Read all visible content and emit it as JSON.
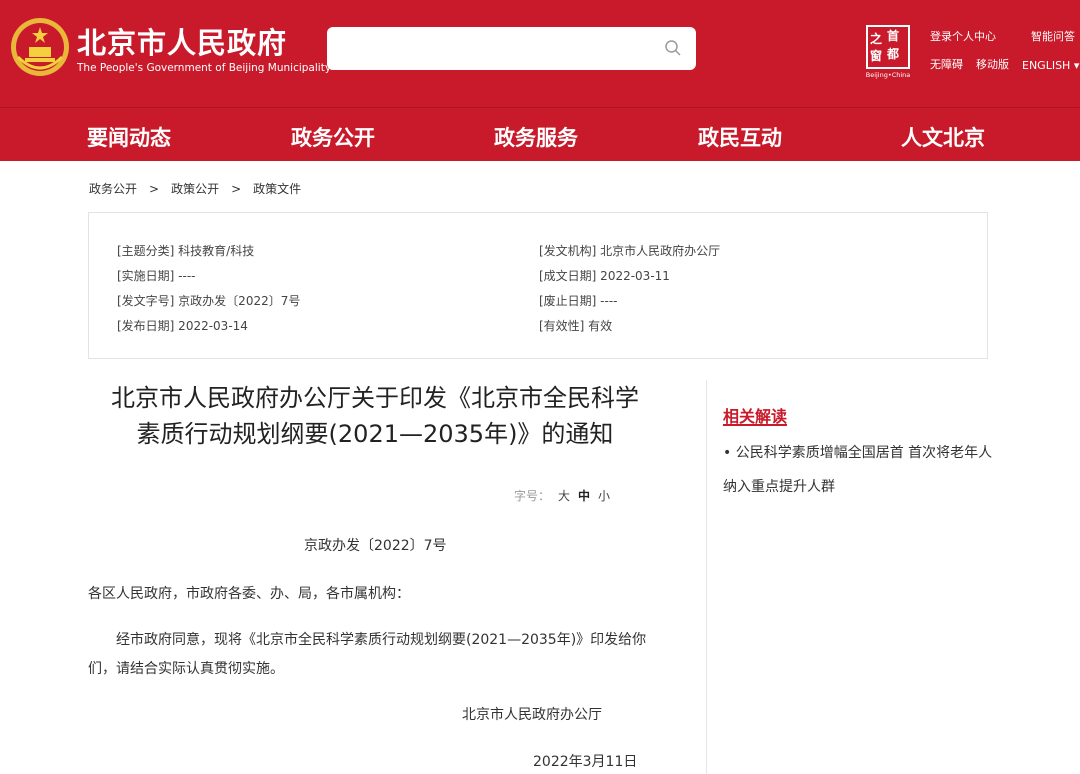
{
  "header": {
    "site_title": "北京市人民政府",
    "site_subtitle": "The People's Government of Beijing Municipality",
    "search": {
      "placeholder": ""
    },
    "capital_logo": {
      "glyphs": [
        "之",
        "首",
        "窗",
        "都"
      ],
      "caption": "Beijing•China"
    },
    "links": {
      "login": "登录个人中心",
      "smart_qa": "智能问答",
      "accessible": "无障碍",
      "mobile": "移动版",
      "english": "ENGLISH ▾"
    },
    "colors": {
      "brand_red": "#c81a2a"
    }
  },
  "nav": {
    "items": [
      {
        "label": "要闻动态"
      },
      {
        "label": "政务公开"
      },
      {
        "label": "政务服务"
      },
      {
        "label": "政民互动"
      },
      {
        "label": "人文北京"
      }
    ]
  },
  "breadcrumb": {
    "items": [
      "政务公开",
      "政策公开",
      "政策文件"
    ],
    "separator": ">"
  },
  "meta": {
    "left": [
      "[主题分类] 科技教育/科技",
      "[实施日期] ----",
      "[发文字号] 京政办发〔2022〕7号",
      "[发布日期] 2022-03-14"
    ],
    "right": [
      "[发文机构] 北京市人民政府办公厅",
      "[成文日期] 2022-03-11",
      "[废止日期] ----",
      "[有效性] 有效"
    ]
  },
  "article": {
    "title_line1": "北京市人民政府办公厅关于印发《北京市全民科学",
    "title_line2": "素质行动规划纲要(2021—2035年)》的通知",
    "font_size_label": "字号：",
    "font_sizes": [
      "大",
      "中",
      "小"
    ],
    "doc_number": "京政办发〔2022〕7号",
    "salutation": "各区人民政府，市政府各委、办、局，各市属机构：",
    "body_line1": "经市政府同意，现将《北京市全民科学素质行动规划纲要(2021—2035年)》印发给你",
    "body_line2": "们，请结合实际认真贯彻实施。",
    "signature": "北京市人民政府办公厅",
    "date": "2022年3月11日"
  },
  "sidebar": {
    "related_title": "相关解读",
    "items": [
      {
        "label": "公民科学素质增幅全国居首 首次将老年人纳入重点提升人群"
      }
    ]
  }
}
